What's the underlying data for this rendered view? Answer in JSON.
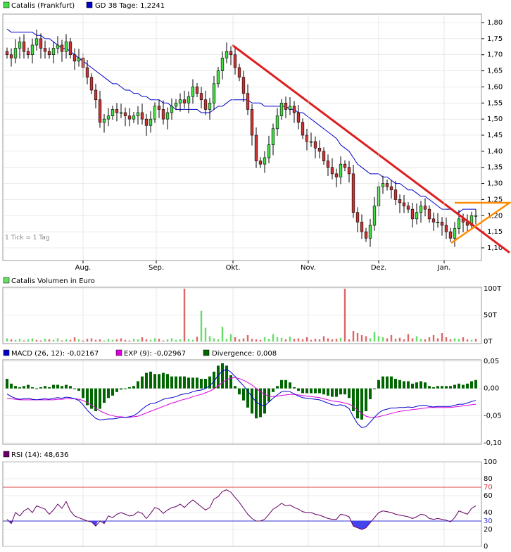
{
  "colors": {
    "up": "#44dd44",
    "down": "#cc3333",
    "gd": "#0000cc",
    "trend": "#e01e1e",
    "triangle": "#ff8c00",
    "vol_up": "#66dd66",
    "vol_down": "#dd6666",
    "macd": "#0000cc",
    "exp": "#dd00dd",
    "div": "#006600",
    "rsi": "#660066",
    "rsi_fill": "#4444ee",
    "grid": "#dddddd",
    "frame": "#999999"
  },
  "header": {
    "price_series": "Catalis (Frankfurt)",
    "gd_label": "GD 38 Tage: 1,2241",
    "tick_note": "1 Tick = 1 Tag",
    "volume_label": "Catalis Volumen in Euro",
    "macd_label": "MACD (26, 12): -0,02167",
    "exp_label": "EXP (9): -0,02967",
    "div_label": "Divergence: 0,008",
    "rsi_label": "RSI (14): 48,636"
  },
  "x_axis": {
    "months": [
      "Aug.",
      "Sep.",
      "Okt.",
      "Nov.",
      "Dez.",
      "Jan."
    ]
  },
  "chart_data": [
    {
      "type": "candlestick",
      "series_name": "Catalis (Frankfurt)",
      "y_ticks": [
        "1,80",
        "1,75",
        "1,70",
        "1,65",
        "1,60",
        "1,55",
        "1,50",
        "1,45",
        "1,40",
        "1,35",
        "1,30",
        "1,25",
        "1,20",
        "1,15",
        "1,10"
      ],
      "ylim": [
        1.08,
        1.84
      ],
      "closes": [
        1.7,
        1.69,
        1.72,
        1.74,
        1.71,
        1.7,
        1.73,
        1.75,
        1.72,
        1.71,
        1.7,
        1.72,
        1.73,
        1.71,
        1.74,
        1.7,
        1.68,
        1.69,
        1.66,
        1.63,
        1.59,
        1.56,
        1.49,
        1.5,
        1.51,
        1.53,
        1.52,
        1.52,
        1.51,
        1.5,
        1.51,
        1.52,
        1.5,
        1.48,
        1.5,
        1.54,
        1.53,
        1.5,
        1.52,
        1.54,
        1.55,
        1.56,
        1.55,
        1.57,
        1.6,
        1.58,
        1.56,
        1.53,
        1.55,
        1.61,
        1.65,
        1.69,
        1.71,
        1.7,
        1.66,
        1.63,
        1.58,
        1.53,
        1.45,
        1.37,
        1.36,
        1.38,
        1.42,
        1.47,
        1.51,
        1.55,
        1.53,
        1.54,
        1.52,
        1.49,
        1.45,
        1.43,
        1.43,
        1.41,
        1.4,
        1.37,
        1.35,
        1.33,
        1.32,
        1.36,
        1.35,
        1.33,
        1.21,
        1.18,
        1.15,
        1.13,
        1.17,
        1.23,
        1.29,
        1.3,
        1.29,
        1.28,
        1.25,
        1.24,
        1.23,
        1.22,
        1.19,
        1.21,
        1.23,
        1.22,
        1.19,
        1.18,
        1.18,
        1.17,
        1.15,
        1.13,
        1.16,
        1.19,
        1.18,
        1.17,
        1.2,
        1.2
      ],
      "gd_values": [
        1.78,
        1.77,
        1.77,
        1.77,
        1.77,
        1.77,
        1.77,
        1.76,
        1.76,
        1.75,
        1.75,
        1.74,
        1.73,
        1.72,
        1.72,
        1.71,
        1.7,
        1.69,
        1.68,
        1.67,
        1.66,
        1.65,
        1.64,
        1.63,
        1.62,
        1.61,
        1.61,
        1.6,
        1.59,
        1.59,
        1.58,
        1.58,
        1.57,
        1.57,
        1.56,
        1.56,
        1.56,
        1.55,
        1.55,
        1.54,
        1.53,
        1.53,
        1.53,
        1.53,
        1.53,
        1.53,
        1.52,
        1.52,
        1.52,
        1.53,
        1.54,
        1.54,
        1.55,
        1.56,
        1.56,
        1.56,
        1.56,
        1.56,
        1.55,
        1.55,
        1.55,
        1.54,
        1.54,
        1.54,
        1.54,
        1.54,
        1.54,
        1.53,
        1.53,
        1.52,
        1.52,
        1.51,
        1.5,
        1.49,
        1.48,
        1.47,
        1.46,
        1.45,
        1.44,
        1.42,
        1.41,
        1.4,
        1.38,
        1.36,
        1.35,
        1.34,
        1.33,
        1.33,
        1.33,
        1.32,
        1.32,
        1.31,
        1.3,
        1.3,
        1.29,
        1.28,
        1.28,
        1.27,
        1.26,
        1.26,
        1.25,
        1.24,
        1.23,
        1.22,
        1.22,
        1.22,
        1.21,
        1.21,
        1.22,
        1.22,
        1.22,
        1.22
      ],
      "trend_line": {
        "x_start_index": 51,
        "y_start": 1.73,
        "x_end_index": 111,
        "y_end": 1.09
      },
      "triangle": {
        "apex_index": 104,
        "apex_value": 1.115,
        "top_value": 1.24,
        "right_index": 114,
        "right_value": 1.24
      }
    },
    {
      "type": "bar",
      "series_name": "Catalis Volumen in Euro",
      "y_ticks": [
        "100T",
        "50T",
        "0T"
      ],
      "ylim": [
        0,
        100
      ],
      "values": [
        6,
        4,
        3,
        5,
        2,
        4,
        6,
        3,
        2,
        5,
        4,
        3,
        6,
        2,
        4,
        3,
        8,
        4,
        2,
        5,
        6,
        3,
        4,
        2,
        5,
        3,
        4,
        6,
        3,
        2,
        5,
        4,
        8,
        4,
        3,
        6,
        5,
        2,
        4,
        6,
        3,
        4,
        100,
        5,
        3,
        9,
        58,
        26,
        10,
        6,
        4,
        28,
        5,
        14,
        8,
        4,
        6,
        12,
        5,
        4,
        3,
        8,
        5,
        14,
        8,
        7,
        4,
        9,
        5,
        6,
        4,
        8,
        3,
        5,
        4,
        10,
        6,
        4,
        5,
        7,
        100,
        4,
        20,
        16,
        12,
        10,
        6,
        18,
        10,
        8,
        6,
        12,
        5,
        7,
        4,
        14,
        6,
        10,
        5,
        4,
        8,
        12,
        6,
        16,
        8,
        4,
        6,
        5,
        8,
        4,
        3,
        5
      ],
      "up_flags": [
        1,
        0,
        1,
        1,
        0,
        1,
        1,
        0,
        0,
        1,
        0,
        1,
        1,
        0,
        1,
        0,
        0,
        1,
        0,
        0,
        0,
        0,
        0,
        1,
        1,
        1,
        0,
        0,
        0,
        0,
        1,
        1,
        0,
        0,
        1,
        1,
        0,
        0,
        1,
        1,
        1,
        1,
        0,
        1,
        1,
        0,
        1,
        1,
        1,
        1,
        1,
        1,
        1,
        1,
        0,
        0,
        0,
        0,
        0,
        0,
        0,
        1,
        1,
        1,
        1,
        1,
        0,
        1,
        0,
        0,
        0,
        0,
        0,
        0,
        0,
        0,
        0,
        0,
        0,
        1,
        0,
        0,
        0,
        0,
        0,
        0,
        1,
        1,
        1,
        1,
        0,
        0,
        0,
        0,
        0,
        0,
        0,
        1,
        1,
        0,
        0,
        0,
        0,
        0,
        0,
        0,
        1,
        1,
        0,
        0,
        1,
        0
      ]
    },
    {
      "type": "line",
      "series_name": "MACD / EXP / Divergence",
      "y_ticks": [
        "0,05",
        "0,00",
        "-0,05",
        "-0,10"
      ],
      "ylim": [
        -0.1,
        0.05
      ],
      "macd": [
        -0.01,
        -0.015,
        -0.018,
        -0.02,
        -0.019,
        -0.018,
        -0.02,
        -0.021,
        -0.02,
        -0.019,
        -0.02,
        -0.018,
        -0.017,
        -0.018,
        -0.016,
        -0.017,
        -0.019,
        -0.022,
        -0.03,
        -0.04,
        -0.048,
        -0.055,
        -0.058,
        -0.057,
        -0.056,
        -0.056,
        -0.055,
        -0.053,
        -0.053,
        -0.052,
        -0.05,
        -0.045,
        -0.038,
        -0.032,
        -0.028,
        -0.027,
        -0.024,
        -0.02,
        -0.018,
        -0.017,
        -0.015,
        -0.012,
        -0.01,
        -0.009,
        -0.006,
        -0.004,
        -0.003,
        0.0,
        0.005,
        0.013,
        0.024,
        0.032,
        0.035,
        0.03,
        0.022,
        0.013,
        0.005,
        -0.005,
        -0.015,
        -0.025,
        -0.03,
        -0.032,
        -0.025,
        -0.018,
        -0.012,
        -0.006,
        -0.005,
        -0.006,
        -0.01,
        -0.014,
        -0.017,
        -0.018,
        -0.019,
        -0.02,
        -0.021,
        -0.024,
        -0.027,
        -0.03,
        -0.031,
        -0.03,
        -0.032,
        -0.037,
        -0.052,
        -0.065,
        -0.072,
        -0.07,
        -0.062,
        -0.053,
        -0.045,
        -0.04,
        -0.038,
        -0.036,
        -0.036,
        -0.035,
        -0.035,
        -0.034,
        -0.035,
        -0.033,
        -0.031,
        -0.031,
        -0.033,
        -0.034,
        -0.033,
        -0.033,
        -0.033,
        -0.033,
        -0.031,
        -0.029,
        -0.029,
        -0.027,
        -0.024,
        -0.022
      ],
      "exp": [
        -0.018,
        -0.019,
        -0.02,
        -0.021,
        -0.021,
        -0.021,
        -0.021,
        -0.021,
        -0.021,
        -0.021,
        -0.021,
        -0.021,
        -0.02,
        -0.02,
        -0.019,
        -0.019,
        -0.019,
        -0.02,
        -0.022,
        -0.026,
        -0.031,
        -0.036,
        -0.041,
        -0.045,
        -0.048,
        -0.05,
        -0.052,
        -0.052,
        -0.053,
        -0.053,
        -0.052,
        -0.051,
        -0.048,
        -0.045,
        -0.042,
        -0.039,
        -0.036,
        -0.033,
        -0.03,
        -0.027,
        -0.025,
        -0.022,
        -0.02,
        -0.018,
        -0.015,
        -0.013,
        -0.011,
        -0.008,
        -0.005,
        -0.001,
        0.005,
        0.011,
        0.016,
        0.019,
        0.02,
        0.018,
        0.015,
        0.011,
        0.006,
        0.0,
        -0.006,
        -0.011,
        -0.014,
        -0.015,
        -0.014,
        -0.013,
        -0.012,
        -0.011,
        -0.011,
        -0.012,
        -0.013,
        -0.014,
        -0.015,
        -0.016,
        -0.017,
        -0.019,
        -0.021,
        -0.023,
        -0.024,
        -0.025,
        -0.027,
        -0.029,
        -0.033,
        -0.04,
        -0.046,
        -0.051,
        -0.053,
        -0.053,
        -0.052,
        -0.05,
        -0.048,
        -0.046,
        -0.044,
        -0.042,
        -0.041,
        -0.04,
        -0.039,
        -0.038,
        -0.037,
        -0.036,
        -0.035,
        -0.035,
        -0.035,
        -0.035,
        -0.035,
        -0.035,
        -0.034,
        -0.033,
        -0.032,
        -0.031,
        -0.03,
        -0.029
      ]
    },
    {
      "type": "line",
      "series_name": "RSI (14)",
      "y_ticks": [
        "100",
        "80",
        "70",
        "60",
        "40",
        "30",
        "20",
        "0"
      ],
      "ylim": [
        0,
        100
      ],
      "levels": [
        70,
        30
      ],
      "values": [
        32,
        27,
        40,
        36,
        42,
        45,
        40,
        48,
        46,
        44,
        38,
        43,
        50,
        45,
        53,
        42,
        36,
        34,
        32,
        30,
        29,
        24,
        30,
        27,
        36,
        34,
        38,
        40,
        38,
        36,
        37,
        41,
        39,
        33,
        39,
        46,
        44,
        39,
        43,
        46,
        47,
        50,
        46,
        51,
        55,
        51,
        47,
        43,
        46,
        56,
        59,
        65,
        67,
        64,
        58,
        52,
        45,
        38,
        33,
        30,
        30,
        32,
        38,
        44,
        47,
        51,
        48,
        49,
        46,
        44,
        41,
        40,
        40,
        38,
        37,
        35,
        33,
        32,
        32,
        38,
        37,
        35,
        24,
        22,
        20,
        22,
        28,
        34,
        40,
        42,
        41,
        40,
        38,
        37,
        36,
        35,
        33,
        35,
        38,
        37,
        33,
        32,
        33,
        32,
        31,
        29,
        34,
        42,
        40,
        38,
        45,
        48
      ]
    }
  ]
}
